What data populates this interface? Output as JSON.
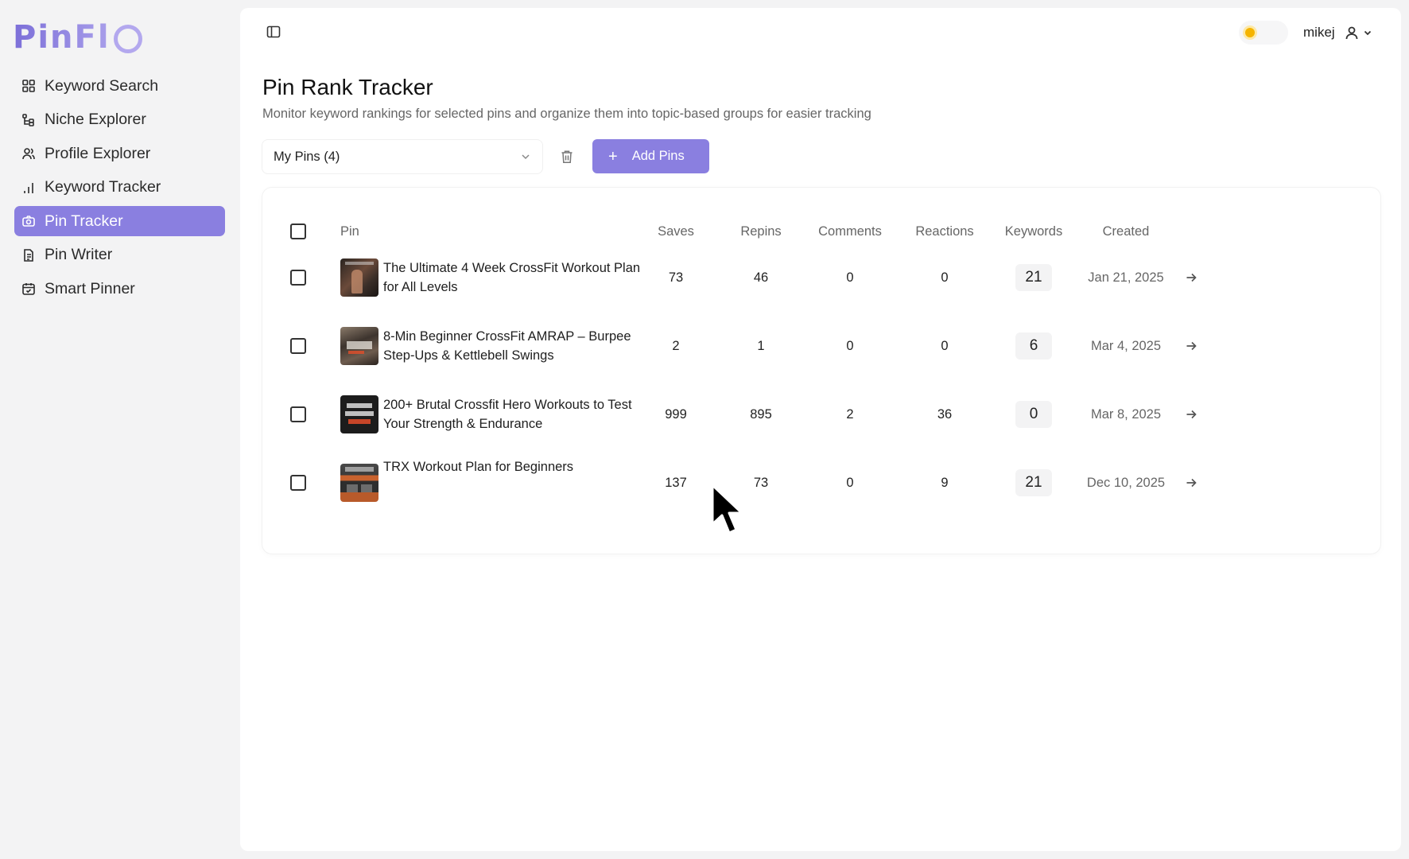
{
  "app": {
    "logo": "PinFl",
    "brand_color": "#8a7fe0"
  },
  "sidebar": {
    "items": [
      {
        "label": "Keyword Search",
        "icon": "grid-icon"
      },
      {
        "label": "Niche Explorer",
        "icon": "hierarchy-icon"
      },
      {
        "label": "Profile Explorer",
        "icon": "users-icon"
      },
      {
        "label": "Keyword Tracker",
        "icon": "bar-chart-icon"
      },
      {
        "label": "Pin Tracker",
        "icon": "camera-icon",
        "active": true
      },
      {
        "label": "Pin Writer",
        "icon": "document-icon"
      },
      {
        "label": "Smart Pinner",
        "icon": "calendar-icon"
      }
    ]
  },
  "header": {
    "username": "mikej"
  },
  "page": {
    "title": "Pin Rank Tracker",
    "subtitle": "Monitor keyword rankings for selected pins and organize them into topic-based groups for easier tracking"
  },
  "toolbar": {
    "group_select_value": "My Pins (4)",
    "add_pins_label": "Add Pins"
  },
  "table": {
    "columns": [
      "Pin",
      "Saves",
      "Repins",
      "Comments",
      "Reactions",
      "Keywords",
      "Created"
    ],
    "rows": [
      {
        "title": "The Ultimate 4 Week CrossFit Workout Plan for All Levels",
        "saves": "73",
        "repins": "46",
        "comments": "0",
        "reactions": "0",
        "keywords": "21",
        "created": "Jan 21, 2025"
      },
      {
        "title": "8-Min Beginner CrossFit AMRAP – Burpee Step-Ups & Kettlebell Swings",
        "saves": "2",
        "repins": "1",
        "comments": "0",
        "reactions": "0",
        "keywords": "6",
        "created": "Mar 4, 2025"
      },
      {
        "title": "200+ Brutal Crossfit Hero Workouts to Test Your Strength & Endurance",
        "saves": "999",
        "repins": "895",
        "comments": "2",
        "reactions": "36",
        "keywords": "0",
        "created": "Mar 8, 2025"
      },
      {
        "title": "TRX Workout Plan for Beginners",
        "saves": "137",
        "repins": "73",
        "comments": "0",
        "reactions": "9",
        "keywords": "21",
        "created": "Dec 10, 2025"
      }
    ]
  }
}
